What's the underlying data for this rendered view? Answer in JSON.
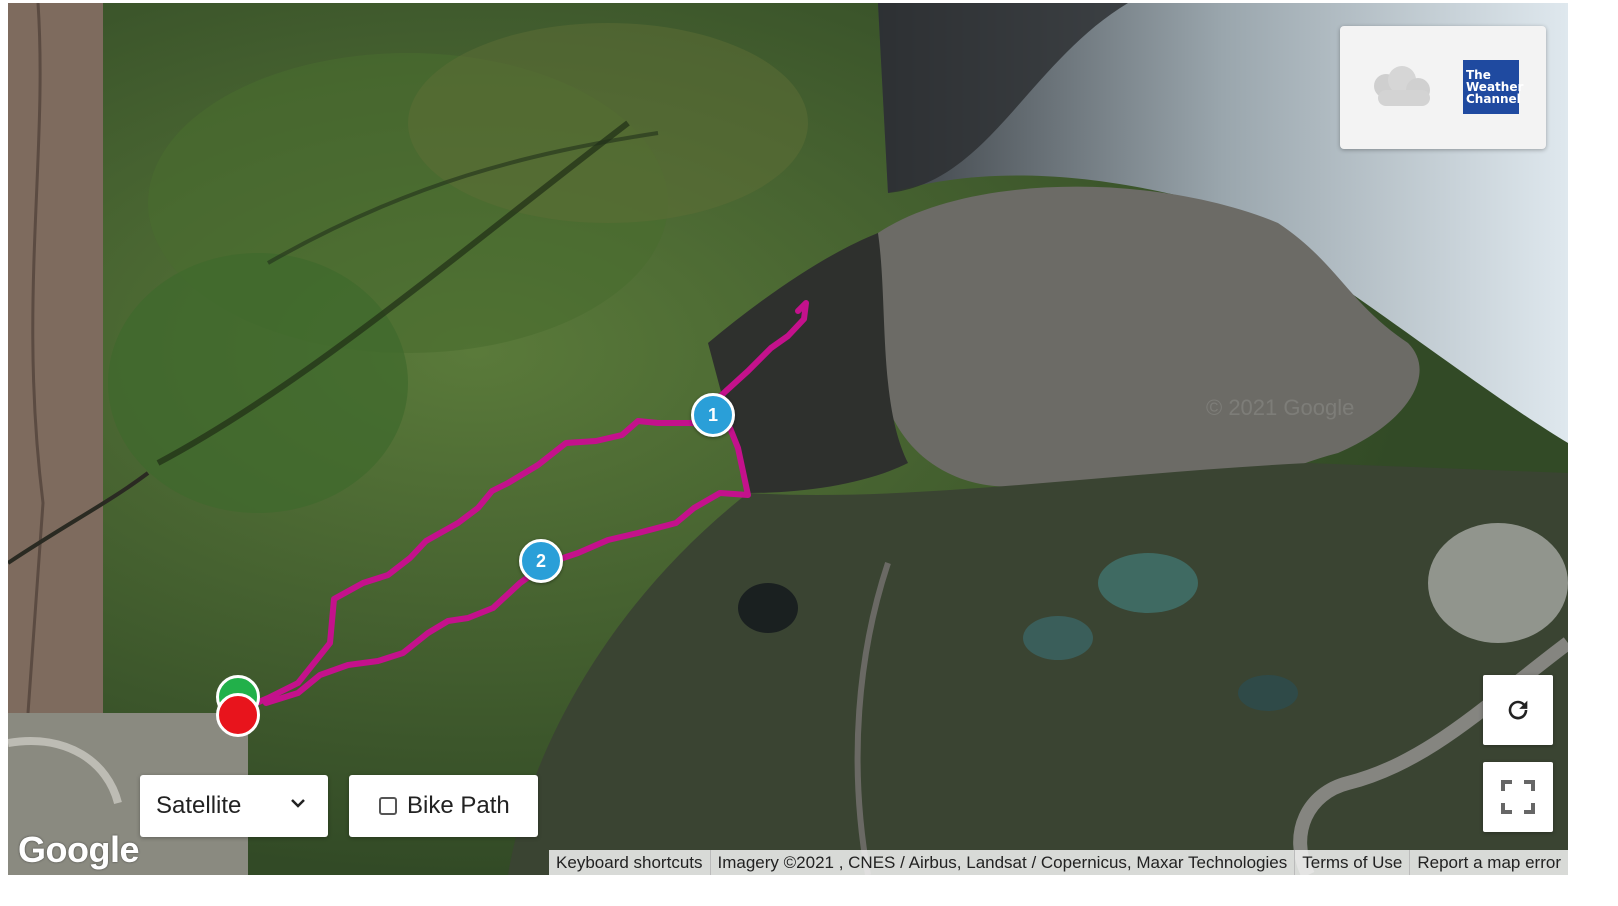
{
  "map": {
    "type_selector": {
      "selected": "Satellite"
    },
    "bike_path": {
      "label": "Bike Path",
      "checked": false
    },
    "markers": [
      {
        "label": "1"
      },
      {
        "label": "2"
      }
    ],
    "route_color": "#c4118c",
    "start_color": "#22b04a",
    "end_color": "#e8141c",
    "watermark": "© 2021 Google"
  },
  "weather_widget": {
    "icon": "cloud-icon",
    "logo_line1": "The",
    "logo_line2": "Weather",
    "logo_line3": "Channel",
    "logo_color": "#1f4aa0"
  },
  "controls": {
    "refresh_icon": "refresh-icon",
    "fullscreen_icon": "fullscreen-icon"
  },
  "footer": {
    "google_logo": "Google",
    "keyboard_shortcuts": "Keyboard shortcuts",
    "imagery": "Imagery ©2021 , CNES / Airbus, Landsat / Copernicus, Maxar Technologies",
    "terms": "Terms of Use",
    "report": "Report a map error"
  }
}
